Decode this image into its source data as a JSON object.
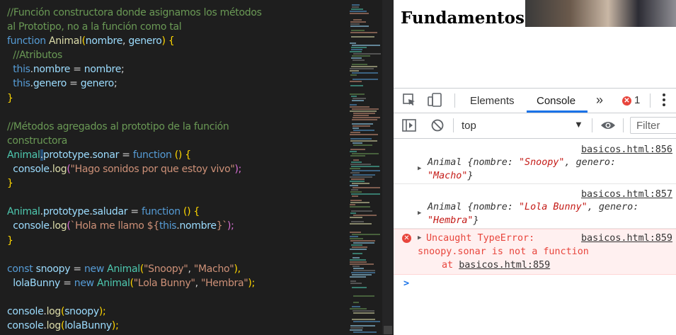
{
  "editor": {
    "lines": [
      [
        {
          "t": "//Función constructora donde asignamos los métodos",
          "c": "c-com"
        }
      ],
      [
        {
          "t": "al Prototipo, no a la función como tal",
          "c": "c-com"
        }
      ],
      [
        {
          "t": "function ",
          "c": "c-kw"
        },
        {
          "t": "Animal",
          "c": "c-fn"
        },
        {
          "t": "(",
          "c": "c-br"
        },
        {
          "t": "nombre",
          "c": "c-var"
        },
        {
          "t": ", ",
          "c": "c-plain"
        },
        {
          "t": "genero",
          "c": "c-var"
        },
        {
          "t": ") {",
          "c": "c-br"
        }
      ],
      [
        {
          "t": "  //Atributos",
          "c": "c-com"
        }
      ],
      [
        {
          "t": "  this",
          "c": "c-kw"
        },
        {
          "t": ".",
          "c": "c-plain"
        },
        {
          "t": "nombre",
          "c": "c-var"
        },
        {
          "t": " = ",
          "c": "c-plain"
        },
        {
          "t": "nombre",
          "c": "c-var"
        },
        {
          "t": ";",
          "c": "c-plain"
        }
      ],
      [
        {
          "t": "  this",
          "c": "c-kw"
        },
        {
          "t": ".",
          "c": "c-plain"
        },
        {
          "t": "genero",
          "c": "c-var"
        },
        {
          "t": " = ",
          "c": "c-plain"
        },
        {
          "t": "genero",
          "c": "c-var"
        },
        {
          "t": ";",
          "c": "c-plain"
        }
      ],
      [
        {
          "t": "}",
          "c": "c-br"
        }
      ],
      [
        {
          "t": "",
          "c": "c-plain"
        }
      ],
      [
        {
          "t": "//Métodos agregados al prototipo de la función",
          "c": "c-com"
        }
      ],
      [
        {
          "t": "constructora",
          "c": "c-com"
        }
      ],
      [
        {
          "t": "Animal",
          "c": "c-type"
        },
        {
          "t": ".",
          "c": "c-plain cursor"
        },
        {
          "t": "prototype",
          "c": "c-var"
        },
        {
          "t": ".",
          "c": "c-plain"
        },
        {
          "t": "sonar",
          "c": "c-var"
        },
        {
          "t": " = ",
          "c": "c-plain"
        },
        {
          "t": "function ",
          "c": "c-kw"
        },
        {
          "t": "() {",
          "c": "c-br"
        }
      ],
      [
        {
          "t": "  console",
          "c": "c-var"
        },
        {
          "t": ".",
          "c": "c-plain"
        },
        {
          "t": "log",
          "c": "c-fn"
        },
        {
          "t": "(",
          "c": "c-br2"
        },
        {
          "t": "\"Hago sonidos por que estoy vivo\"",
          "c": "c-str"
        },
        {
          "t": ");",
          "c": "c-br2"
        }
      ],
      [
        {
          "t": "}",
          "c": "c-br"
        }
      ],
      [
        {
          "t": "",
          "c": "c-plain"
        }
      ],
      [
        {
          "t": "Animal",
          "c": "c-type"
        },
        {
          "t": ".",
          "c": "c-plain"
        },
        {
          "t": "prototype",
          "c": "c-var"
        },
        {
          "t": ".",
          "c": "c-plain"
        },
        {
          "t": "saludar",
          "c": "c-var"
        },
        {
          "t": " = ",
          "c": "c-plain"
        },
        {
          "t": "function ",
          "c": "c-kw"
        },
        {
          "t": "() {",
          "c": "c-br"
        }
      ],
      [
        {
          "t": "  console",
          "c": "c-var"
        },
        {
          "t": ".",
          "c": "c-plain"
        },
        {
          "t": "log",
          "c": "c-fn"
        },
        {
          "t": "(",
          "c": "c-br2"
        },
        {
          "t": "`Hola me llamo ${",
          "c": "c-str"
        },
        {
          "t": "this",
          "c": "c-kw"
        },
        {
          "t": ".",
          "c": "c-plain"
        },
        {
          "t": "nombre",
          "c": "c-var"
        },
        {
          "t": "}`",
          "c": "c-str"
        },
        {
          "t": ");",
          "c": "c-br2"
        }
      ],
      [
        {
          "t": "}",
          "c": "c-br"
        }
      ],
      [
        {
          "t": "",
          "c": "c-plain"
        }
      ],
      [
        {
          "t": "const ",
          "c": "c-kw"
        },
        {
          "t": "snoopy",
          "c": "c-var"
        },
        {
          "t": " = ",
          "c": "c-plain"
        },
        {
          "t": "new ",
          "c": "c-kw"
        },
        {
          "t": "Animal",
          "c": "c-type"
        },
        {
          "t": "(",
          "c": "c-br"
        },
        {
          "t": "\"Snoopy\"",
          "c": "c-str"
        },
        {
          "t": ", ",
          "c": "c-plain"
        },
        {
          "t": "\"Macho\"",
          "c": "c-str"
        },
        {
          "t": "),",
          "c": "c-br"
        }
      ],
      [
        {
          "t": "  lolaBunny",
          "c": "c-var"
        },
        {
          "t": " = ",
          "c": "c-plain"
        },
        {
          "t": "new ",
          "c": "c-kw"
        },
        {
          "t": "Animal",
          "c": "c-type"
        },
        {
          "t": "(",
          "c": "c-br"
        },
        {
          "t": "\"Lola Bunny\"",
          "c": "c-str"
        },
        {
          "t": ", ",
          "c": "c-plain"
        },
        {
          "t": "\"Hembra\"",
          "c": "c-str"
        },
        {
          "t": ");",
          "c": "c-br"
        }
      ],
      [
        {
          "t": "",
          "c": "c-plain"
        }
      ],
      [
        {
          "t": "console",
          "c": "c-var"
        },
        {
          "t": ".",
          "c": "c-plain"
        },
        {
          "t": "log",
          "c": "c-fn"
        },
        {
          "t": "(",
          "c": "c-br"
        },
        {
          "t": "snoopy",
          "c": "c-var"
        },
        {
          "t": ");",
          "c": "c-br"
        }
      ],
      [
        {
          "t": "console",
          "c": "c-var"
        },
        {
          "t": ".",
          "c": "c-plain"
        },
        {
          "t": "log",
          "c": "c-fn"
        },
        {
          "t": "(",
          "c": "c-br"
        },
        {
          "t": "lolaBunny",
          "c": "c-var"
        },
        {
          "t": ");",
          "c": "c-br"
        }
      ]
    ]
  },
  "browser": {
    "page_title": "Fundamentos J"
  },
  "devtools": {
    "tabs": {
      "elements": "Elements",
      "console": "Console",
      "more": "»"
    },
    "error_count": "1",
    "toolbar": {
      "context": "top",
      "filter_placeholder": "Filter"
    },
    "icons": {
      "inspect": "inspect-element-icon",
      "device": "device-toolbar-icon",
      "menu": "kebab-menu-icon",
      "sidebar": "sidebar-toggle-icon",
      "clear": "clear-console-icon",
      "eye": "live-expression-icon"
    },
    "messages": [
      {
        "source": "basicos.html:856",
        "prefix": "Animal {",
        "k1": "nombre: ",
        "v1": "\"Snoopy\"",
        "k2": ", genero:",
        "v2": "\"Macho\"",
        "suffix": "}"
      },
      {
        "source": "basicos.html:857",
        "prefix": "Animal {",
        "k1": "nombre: ",
        "v1": "\"Lola Bunny\"",
        "k2": ", genero:",
        "v2": "\"Hembra\"",
        "suffix": "}"
      }
    ],
    "error": {
      "source": "basicos.html:859",
      "line1": "Uncaught TypeError:",
      "line2": "snoopy.sonar is not a function",
      "at_prefix": "at ",
      "at_link": "basicos.html:859"
    },
    "prompt": ">"
  },
  "colors": {
    "editor_bg": "#1e1e1e",
    "keyword": "#569cd6",
    "string": "#ce9178",
    "comment": "#6a9955",
    "error_red": "#e8453c",
    "tab_accent": "#1a73e8"
  }
}
